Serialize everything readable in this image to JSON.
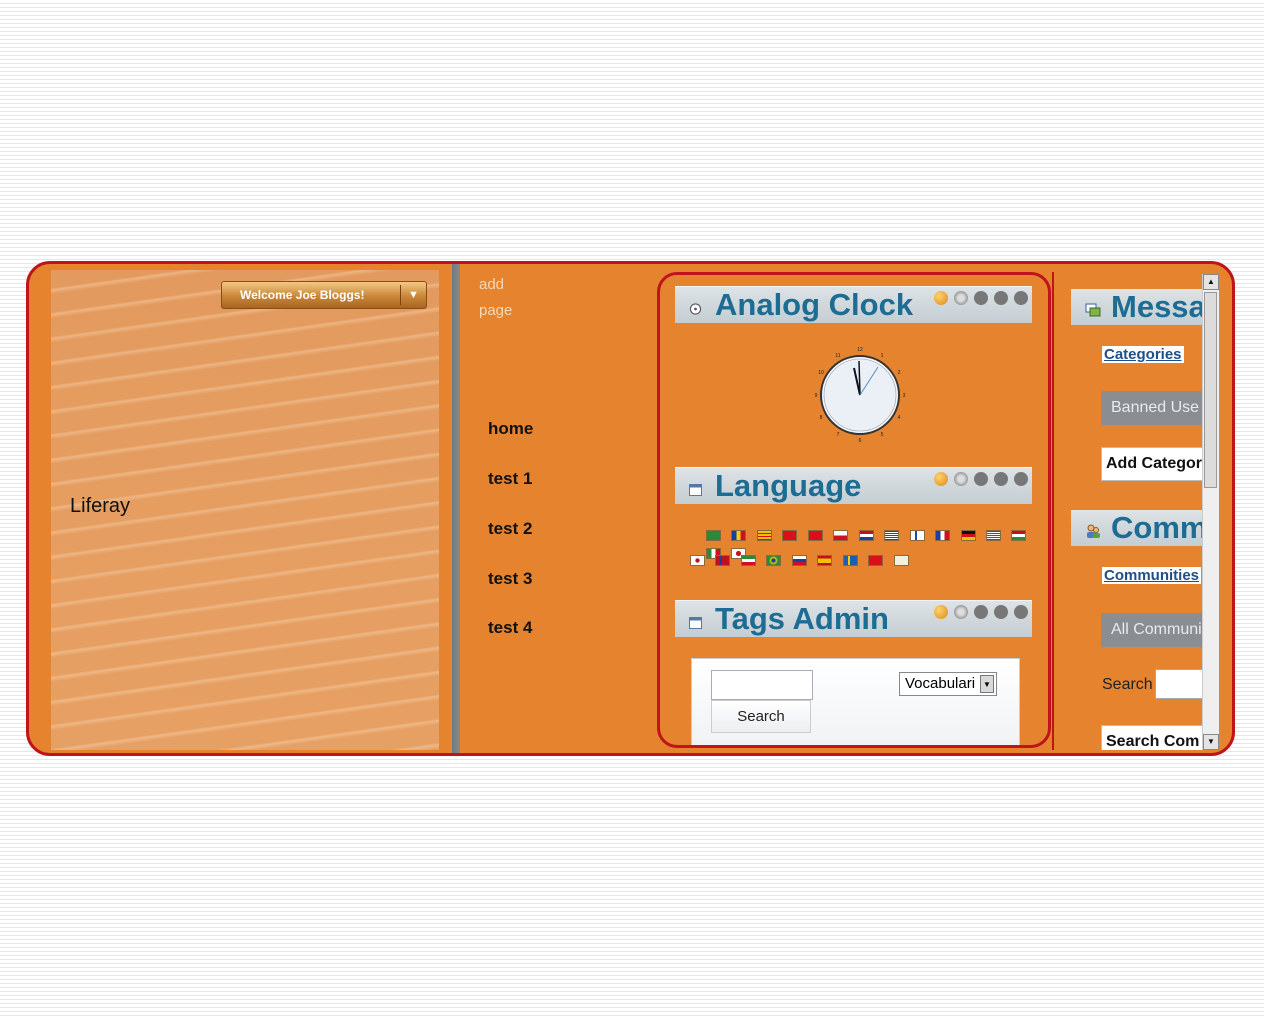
{
  "header": {
    "welcome_label": "Welcome Joe Bloggs!",
    "welcome_arrow": "▼",
    "site_name": "Liferay"
  },
  "nav": {
    "add_page": "add page",
    "items": [
      {
        "label": "home"
      },
      {
        "label": "test 1"
      },
      {
        "label": "test 2"
      },
      {
        "label": "test 3"
      },
      {
        "label": "test 4"
      }
    ]
  },
  "portlets": {
    "clock": {
      "title": "Analog Clock"
    },
    "language": {
      "title": "Language"
    },
    "tags": {
      "title": "Tags Admin",
      "search_button": "Search",
      "vocabulary_select": "Vocabulari"
    }
  },
  "right": {
    "message_title": "Messa",
    "categories_link": "Categories",
    "banned_users_button": "Banned Use",
    "add_category_button": "Add Categor",
    "communities_title": "Comm",
    "communities_link": "Communities",
    "all_communities_button": "All Communi",
    "search_label": "Search",
    "search_communities_button": "Search Com"
  },
  "colors": {
    "background_orange": "#e5832f",
    "border_red": "#c0141b",
    "title_blue": "#1d6c94"
  },
  "icons": [
    "clock-icon",
    "portlet-icon",
    "look-and-feel-icon",
    "configuration-icon",
    "minimize-icon",
    "maximize-icon",
    "close-icon",
    "message-boards-icon",
    "communities-icon"
  ]
}
